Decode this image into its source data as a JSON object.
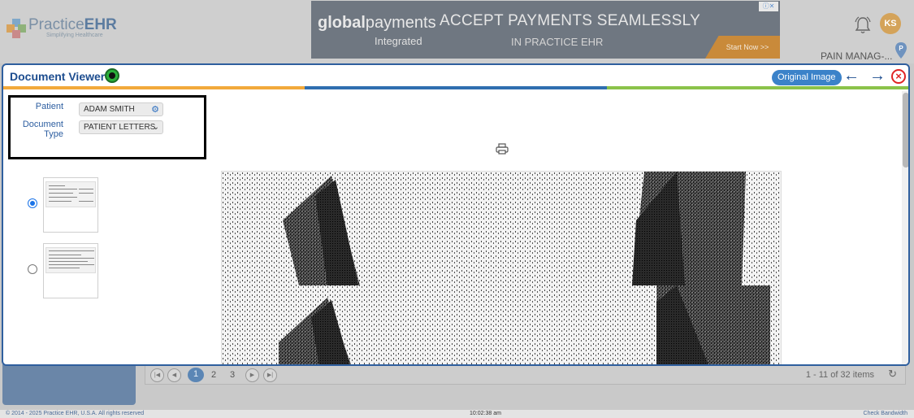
{
  "header": {
    "logo": {
      "name_light": "Practice",
      "name_bold": "EHR",
      "tagline": "Simplifying Healthcare"
    },
    "ad": {
      "brand_bold": "global",
      "brand_light": "payments",
      "brand_sub": "Integrated",
      "headline": "ACCEPT PAYMENTS SEAMLESSLY",
      "subheadline": "IN PRACTICE EHR",
      "cta": "Start Now >>"
    },
    "user_initials": "KS",
    "org_name": "PAIN MANAG-..."
  },
  "viewer": {
    "title": "Document Viewer",
    "original_image_label": "Original Image",
    "prev_arrow": "←",
    "next_arrow": "→",
    "close_glyph": "×",
    "stripe_colors": [
      "#f2a93b",
      "#2f6fb0",
      "#8bc34a"
    ],
    "filters": {
      "patient_label": "Patient",
      "patient_value": "ADAM SMITH",
      "doc_type_label_1": "Document",
      "doc_type_label_2": "Type",
      "doc_type_value": "PATIENT LETTERS"
    },
    "thumbnails": [
      {
        "selected": true
      },
      {
        "selected": false
      }
    ]
  },
  "pager": {
    "pages": [
      "1",
      "2",
      "3"
    ],
    "active_page": "1",
    "info": "1 - 11 of 32 items"
  },
  "footer": {
    "copyright": "© 2014 - 2025 Practice EHR, U.S.A. All rights reserved",
    "time": "10:02:38 am",
    "bandwidth": "Check Bandwidth"
  }
}
